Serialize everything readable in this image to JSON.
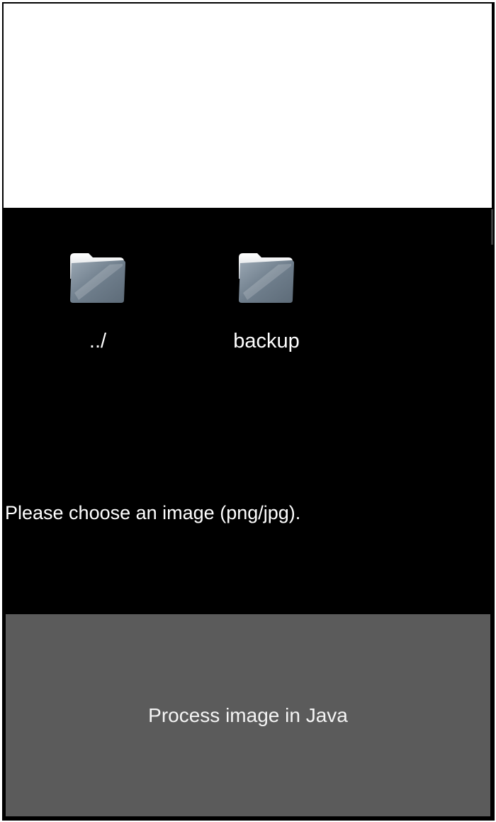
{
  "file_browser": {
    "items": [
      {
        "label": "../",
        "icon": "folder-icon"
      },
      {
        "label": "backup",
        "icon": "folder-icon"
      }
    ]
  },
  "hint_text": "Please choose an image (png/jpg).",
  "process_button": {
    "label": "Process image in Java"
  },
  "colors": {
    "screen_background": "#000000",
    "preview_background": "#ffffff",
    "button_background": "#5b5b5b",
    "text": "#ffffff",
    "folder": "#6f7e8c"
  }
}
